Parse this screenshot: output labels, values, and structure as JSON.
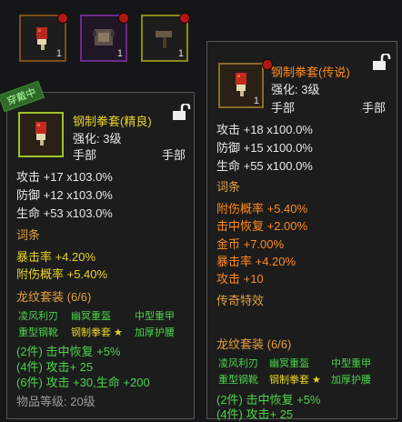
{
  "slots": [
    {
      "count": "1",
      "rarity": "epic-orange"
    },
    {
      "count": "1",
      "rarity": "purple"
    },
    {
      "count": "1",
      "rarity": "yellow-green"
    }
  ],
  "left": {
    "equipped_tag": "穿戴中",
    "name": "钢制拳套(精良)",
    "enhance": "强化: 3级",
    "slot_left": "手部",
    "slot_right": "手部",
    "base_stats": [
      "攻击 +17  x103.0%",
      "防御 +12  x103.0%",
      "生命 +53  x103.0%"
    ],
    "affix_title": "词条",
    "affixes": [
      "暴击率 +4.20%",
      "附伤概率 +5.40%"
    ],
    "set_title": "龙纹套装 (6/6)",
    "set_items": [
      "凌风利刃",
      "幽冥重盔",
      "中型重甲",
      "重型钢靴",
      "钢制拳套 ★",
      "加厚护腰"
    ],
    "set_bonus": [
      "(2件) 击中恢复 +5%",
      "(4件) 攻击+ 25",
      "(6件) 攻击 +30,生命 +200"
    ],
    "item_level": "物品等级: 20级"
  },
  "right": {
    "name": "钢制拳套(传说)",
    "enhance": "强化: 3级",
    "slot_left": "手部",
    "slot_right": "手部",
    "icon_count": "1",
    "base_stats": [
      "攻击 +18  x100.0%",
      "防御 +15  x100.0%",
      "生命 +55  x100.0%"
    ],
    "affix_title": "词条",
    "affixes": [
      "附伤概率 +5.40%",
      "击中恢复 +2.00%",
      "金币 +7.00%",
      "暴击率 +4.20%",
      "攻击 +10"
    ],
    "legend_title": "传奇特效",
    "set_title": "龙纹套装 (6/6)",
    "set_items": [
      "凌风利刃",
      "幽冥重盔",
      "中型重甲",
      "重型钢靴",
      "钢制拳套 ★",
      "加厚护腰"
    ],
    "set_bonus": [
      "(2件) 击中恢复 +5%",
      "(4件) 攻击+ 25"
    ]
  }
}
